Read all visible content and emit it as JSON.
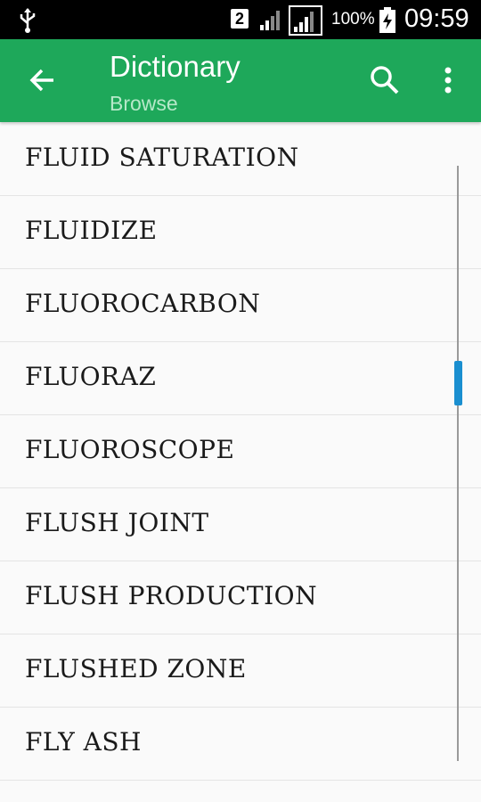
{
  "status_bar": {
    "sim_slot": "2",
    "battery_percent": "100%",
    "time": "09:59"
  },
  "app_bar": {
    "title": "Dictionary",
    "subtitle": "Browse"
  },
  "words": [
    "FLUID SATURATION",
    "FLUIDIZE",
    "FLUOROCARBON",
    "FLUORAZ",
    "FLUOROSCOPE",
    "FLUSH JOINT",
    "FLUSH PRODUCTION",
    "FLUSHED ZONE",
    "FLY ASH"
  ],
  "colors": {
    "app_bar": "#1ea85a",
    "subtitle": "#b6e8c9",
    "scroll_thumb": "#1a8fd0"
  }
}
